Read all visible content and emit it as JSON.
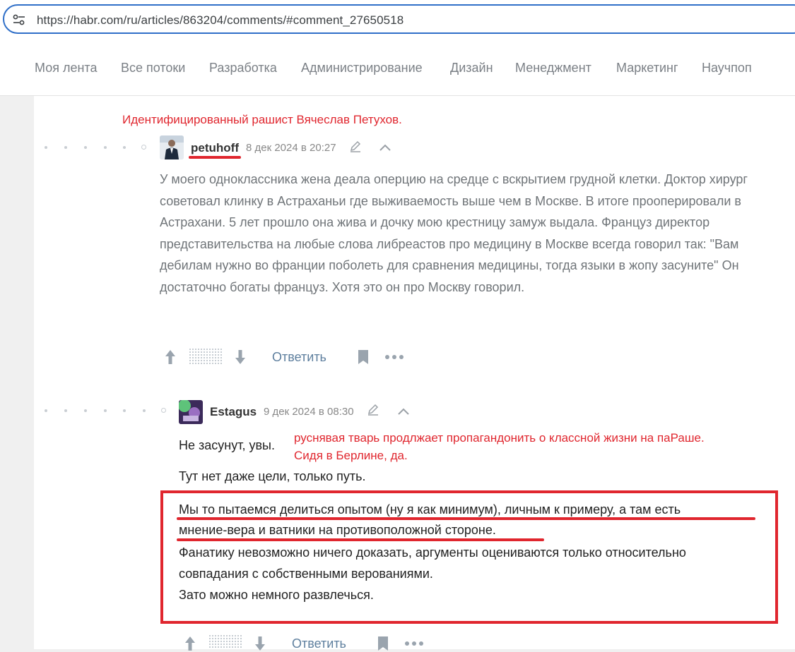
{
  "address_bar": {
    "url": "https://habr.com/ru/articles/863204/comments/#comment_27650518"
  },
  "nav": {
    "items": [
      "Моя лента",
      "Все потоки",
      "Разработка",
      "Администрирование",
      "Дизайн",
      "Менеджмент",
      "Маркетинг",
      "Научпоп"
    ]
  },
  "annotations": {
    "top": "Идентифицированный рашист Вячеслав Петухов.",
    "inline_line1": "руснявая тварь продлжает пропагандонить о классной жизни на паРаше.",
    "inline_line2": "Сидя в Берлине, да."
  },
  "comment1": {
    "author": "petuhoff",
    "date": "8 дек 2024 в 20:27",
    "text": "У моего одноклассника жена деала оперцию на средце с вскрытием грудной клетки. Доктор хирург советовал клинку в Астраханьи где выживаемость выше чем в Москве. В итоге прооперировали в Астрахани. 5 лет прошло она жива и дочку мою крестницу замуж выдала. Француз директор представительства на любые слова либреастов про медицину в Москве всегда говорил так: \"Вам дебилам нужно во франции поболеть для сравнения медицины, тогда языки в жопу засуните\" Он достаточно богаты француз. Хотя это он про Москву говорил.",
    "reply_label": "Ответить"
  },
  "comment2": {
    "author": "Estagus",
    "date": "9 дек 2024 в 08:30",
    "p1": "Не засунут, увы.",
    "p2": "Тут нет даже цели, только путь.",
    "p3_line1": "Мы то пытаемся делиться опытом (ну я как минимум), личным к примеру, а там есть",
    "p3_line2": "мнение-вера и ватники на противоположной стороне.",
    "p3_line3": "Фанатику невозможно ничего доказать, аргументы оцениваются только относительно",
    "p3_line4": "совпадания с собственными верованиями.",
    "p3_line5": "Зато можно немного развлечься.",
    "reply_label": "Ответить"
  },
  "icons": {
    "site_info": "tune-icon",
    "edit": "pencil-icon",
    "collapse": "chevron-up-icon",
    "vote_up": "arrow-up-icon",
    "vote_down": "arrow-down-icon",
    "bookmark": "bookmark-icon",
    "more": "more-dots-icon"
  },
  "colors": {
    "annotation_red": "#e0262e",
    "link_blue": "#5e7f9e",
    "url_border": "#2f6fc8"
  }
}
